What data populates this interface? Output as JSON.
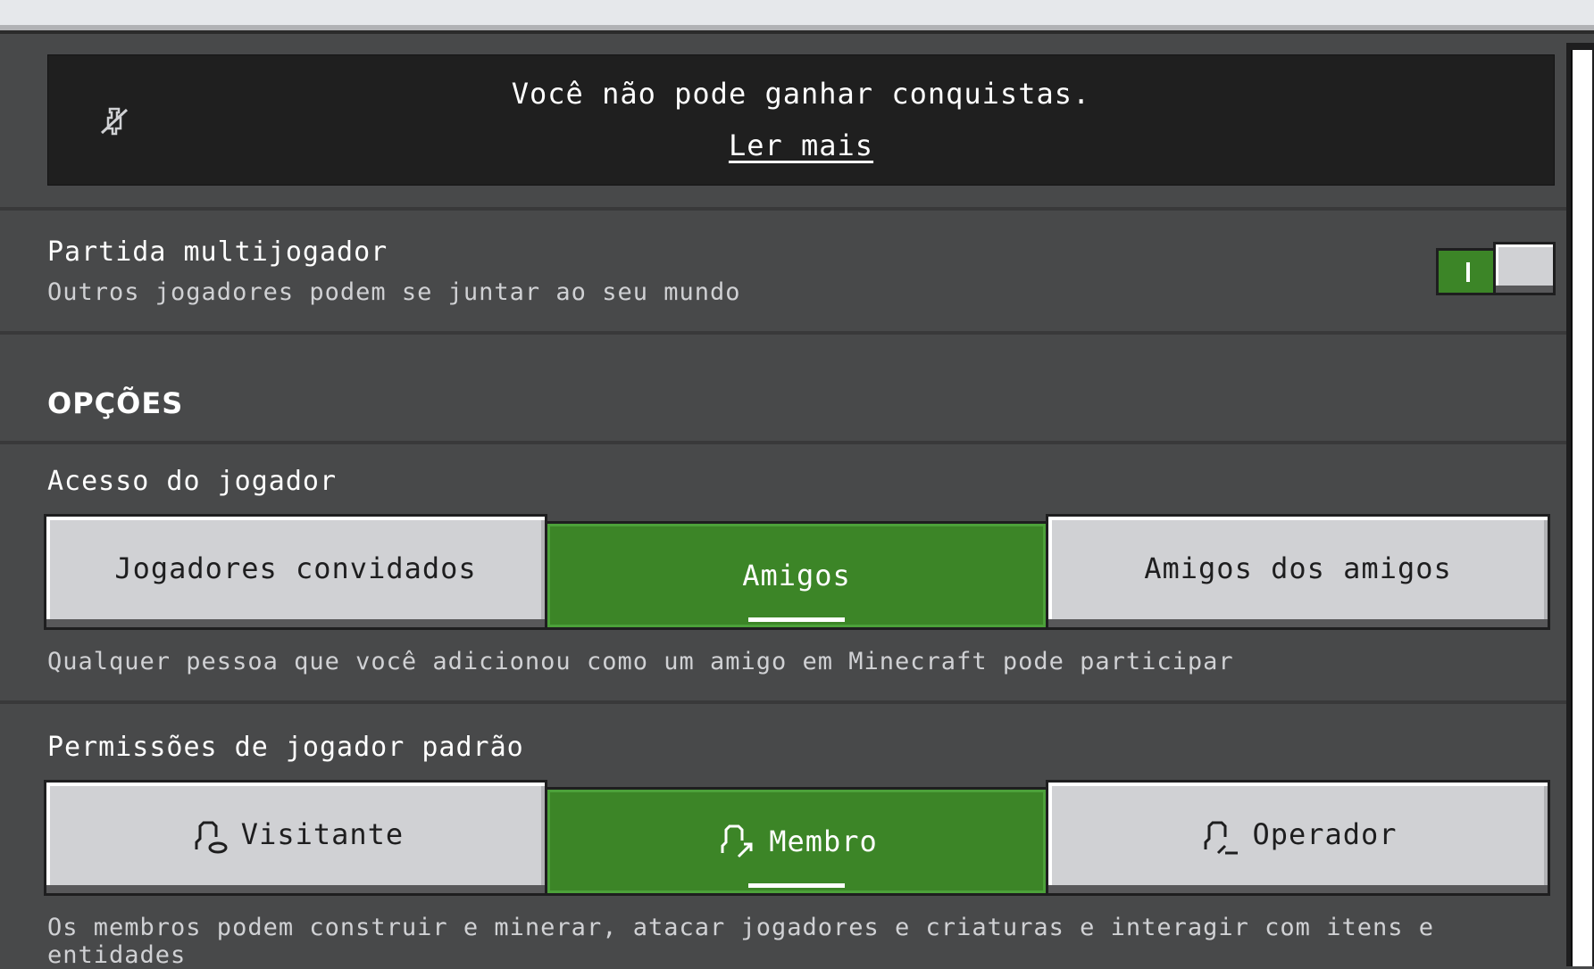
{
  "banner": {
    "message": "Você não pode ganhar conquistas.",
    "link": "Ler mais",
    "icon": "achievement-disabled-icon"
  },
  "multiplayer": {
    "title": "Partida multijogador",
    "subtitle": "Outros jogadores podem se juntar ao seu mundo",
    "enabled": true
  },
  "options": {
    "header": "OPÇÕES"
  },
  "player_access": {
    "title": "Acesso do jogador",
    "options": [
      "Jogadores convidados",
      "Amigos",
      "Amigos dos amigos"
    ],
    "selected": "Amigos",
    "description": "Qualquer pessoa que você adicionou como um amigo em Minecraft pode participar"
  },
  "default_permissions": {
    "title": "Permissões de jogador padrão",
    "options": [
      {
        "label": "Visitante",
        "icon": "visitor-icon"
      },
      {
        "label": "Membro",
        "icon": "member-icon"
      },
      {
        "label": "Operador",
        "icon": "operator-icon"
      }
    ],
    "selected": "Membro",
    "description": "Os membros podem construir e minerar, atacar jogadores e criaturas e interagir com itens e entidades"
  },
  "colors": {
    "background": "#48494a",
    "banner": "#1f1f1f",
    "accent_green": "#3c8527",
    "button_gray": "#d0d1d4"
  }
}
